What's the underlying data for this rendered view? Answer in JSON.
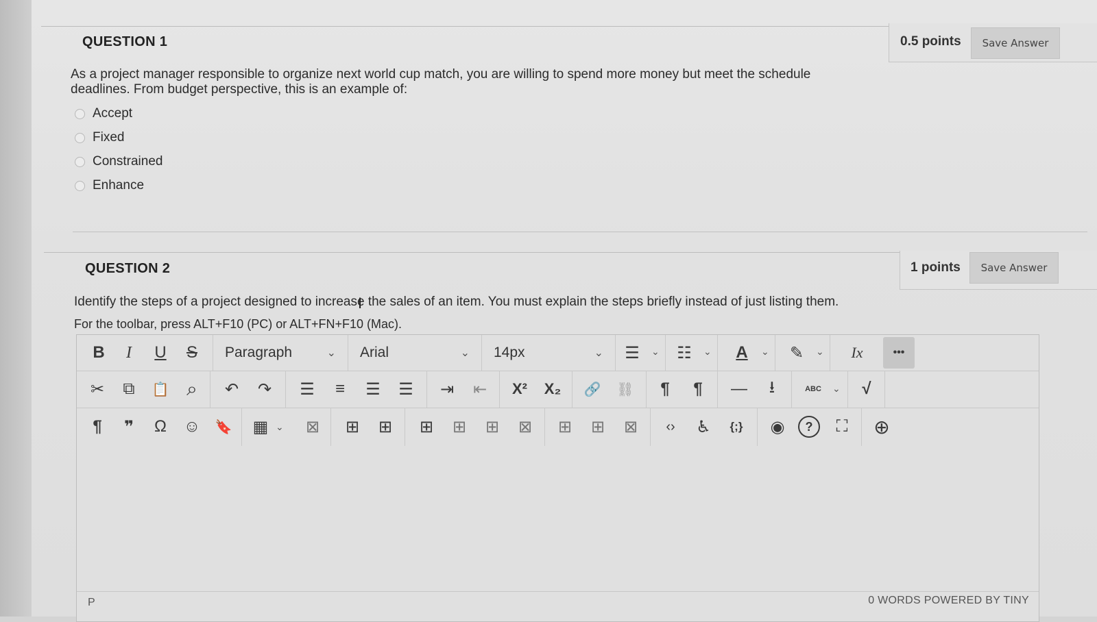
{
  "question1": {
    "title": "QUESTION 1",
    "points": "0.5 points",
    "save_label": "Save Answer",
    "text_line1": "As a project manager responsible to organize next world cup match, you are willing to spend more money but meet the schedule",
    "text_line2": "deadlines. From budget perspective, this is an example of:",
    "options": [
      "Accept",
      "Fixed",
      "Constrained",
      "Enhance"
    ]
  },
  "question2": {
    "title": "QUESTION 2",
    "points": "1 points",
    "save_label": "Save Answer",
    "text": "Identify the steps of a project designed to increase the sales of an item. You must explain the steps briefly instead of just listing them.",
    "toolbar_hint": "For the toolbar, press ALT+F10 (PC) or ALT+FN+F10 (Mac)."
  },
  "editor": {
    "block_format": "Paragraph",
    "font_family": "Arial",
    "font_size": "14px",
    "status_path": "P",
    "status_right": "0 WORDS  POWERED BY TINY",
    "icons_row1": [
      "bold-icon",
      "italic-icon",
      "underline-icon",
      "strikethrough-icon",
      "bullet-list-icon",
      "numbered-list-icon",
      "text-color-icon",
      "highlight-icon",
      "clear-format-icon",
      "more-icon"
    ],
    "icons_row2": [
      "cut-icon",
      "copy-icon",
      "paste-icon",
      "find-icon",
      "undo-icon",
      "redo-icon",
      "align-left-icon",
      "align-center-icon",
      "align-right-icon",
      "justify-icon",
      "indent-icon",
      "outdent-icon",
      "superscript-icon",
      "subscript-icon",
      "link-icon",
      "unlink-icon",
      "ltr-icon",
      "rtl-icon",
      "horizontal-line-icon",
      "insert-icon",
      "spellcheck-icon",
      "math-icon"
    ],
    "icons_row3": [
      "paragraph-mark-icon",
      "blockquote-icon",
      "special-char-icon",
      "emoji-icon",
      "bookmark-icon",
      "table-icon",
      "table-delete-icon",
      "row-above-icon",
      "row-below-icon",
      "cell-props-icon",
      "insert-col-icon",
      "split-cell-icon",
      "merge-cell-icon",
      "col-before-icon",
      "col-after-icon",
      "delete-col-icon",
      "source-code-icon",
      "accessibility-icon",
      "code-sample-icon",
      "preview-icon",
      "help-icon",
      "fullscreen-icon",
      "add-content-icon"
    ]
  },
  "glyphs": {
    "bold": "B",
    "italic": "I",
    "underline": "U",
    "strike": "S",
    "chevron": "⌄",
    "bullet_list": "☰",
    "numbered_list": "☷",
    "text_color": "A",
    "highlight": "✎",
    "clear_format": "Ix",
    "more": "•••",
    "cut": "✂",
    "copy": "⧉",
    "paste": "📋",
    "find": "⌕",
    "undo": "↶",
    "redo": "↷",
    "align_left": "☰",
    "align_center": "≡",
    "align_right": "☰",
    "justify": "☰",
    "indent": "⇥",
    "outdent": "⇤",
    "superscript": "X²",
    "subscript": "X₂",
    "link": "🔗",
    "unlink": "⛓",
    "ltr": "¶",
    "rtl": "¶",
    "hr": "—",
    "insert": "⭳",
    "spell": "ABC",
    "math": "√",
    "pilcrow": "¶",
    "quote": "❞",
    "omega": "Ω",
    "emoji": "☺",
    "bookmark": "🔖",
    "table": "▦",
    "tdel": "⊠",
    "row_above": "⊞",
    "row_below": "⊞",
    "cell_props": "⊞",
    "insert_col": "⊞",
    "split": "⊞",
    "merge": "⊠",
    "col_before": "⊞",
    "col_after": "⊞",
    "del_col": "⊠",
    "source": "‹›",
    "access": "♿",
    "codesample": "{;}",
    "preview": "◉",
    "help": "?",
    "fullscreen": "⛶",
    "add": "⊕",
    "text_cursor": "I"
  }
}
